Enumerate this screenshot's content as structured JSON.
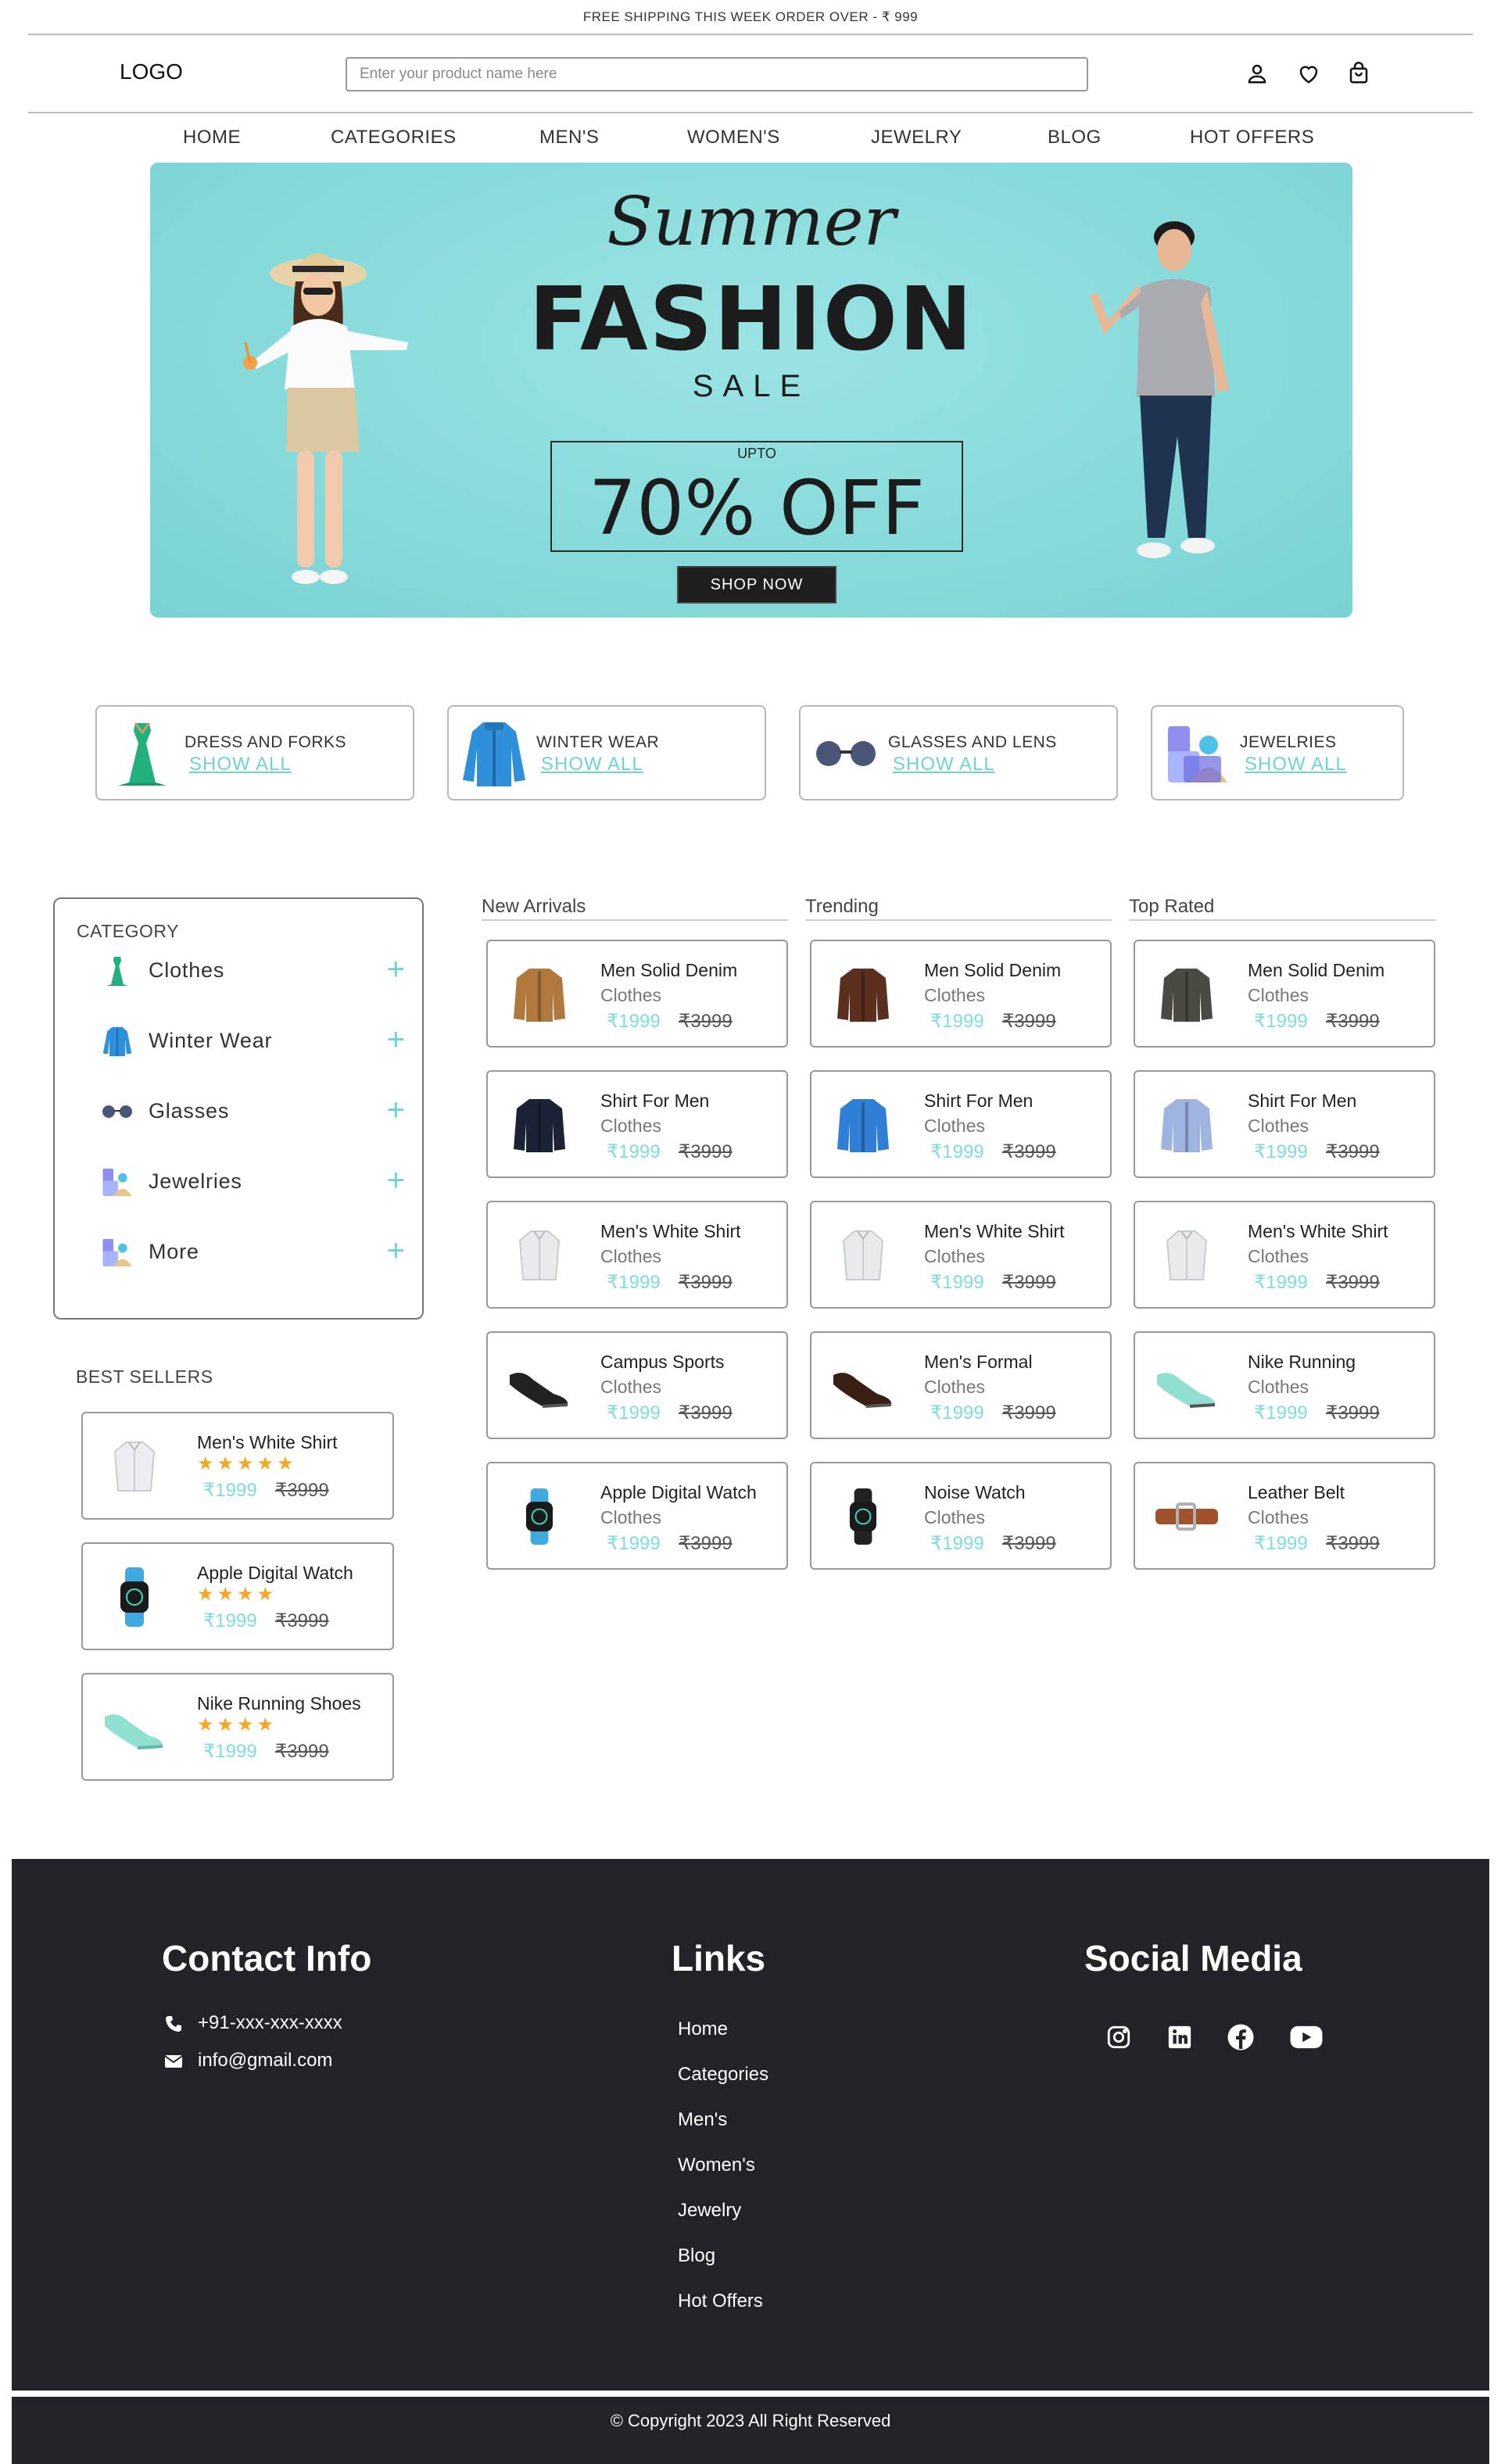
{
  "topbar": {
    "text": "FREE SHIPPING THIS WEEK ORDER OVER - ₹ 999"
  },
  "header": {
    "logo": "LOGO",
    "search_placeholder": "Enter your product name here",
    "icons": [
      "user-icon",
      "heart-icon",
      "shopping-bag-icon"
    ]
  },
  "nav": [
    "HOME",
    "CATEGORIES",
    "MEN'S",
    "WOMEN'S",
    "JEWELRY",
    "BLOG",
    "HOT OFFERS"
  ],
  "banner": {
    "script_title": "Summer",
    "title": "FASHION",
    "subtitle": "SALE",
    "upto": "UPTO",
    "offer": "70% OFF",
    "button": "SHOP NOW",
    "bg_color": "#86dada"
  },
  "categories": [
    {
      "title": "DRESS AND FORKS",
      "link": "SHOW ALL",
      "icon": "dress-icon"
    },
    {
      "title": "WINTER WEAR",
      "link": "SHOW ALL",
      "icon": "jacket-icon"
    },
    {
      "title": "GLASSES AND LENS",
      "link": "SHOW ALL",
      "icon": "glasses-icon"
    },
    {
      "title": "JEWELRIES",
      "link": "SHOW ALL",
      "icon": "jewelry-icon"
    }
  ],
  "sidebar": {
    "heading": "CATEGORY",
    "items": [
      {
        "label": "Clothes",
        "icon": "dress-icon"
      },
      {
        "label": "Winter Wear",
        "icon": "jacket-icon"
      },
      {
        "label": "Glasses",
        "icon": "glasses-icon"
      },
      {
        "label": "Jewelries",
        "icon": "jewelry-icon"
      },
      {
        "label": "More",
        "icon": "jewelry-icon"
      }
    ],
    "plus": "+"
  },
  "best_sellers": {
    "heading": "BEST SELLERS",
    "items": [
      {
        "name": "Men's White Shirt",
        "stars": "★★★★★",
        "rating": 5,
        "price": "₹1999",
        "old_price": "₹3999",
        "icon": "white-shirt-icon"
      },
      {
        "name": "Apple Digital Watch",
        "stars": "★★★★",
        "rating": 4,
        "price": "₹1999",
        "old_price": "₹3999",
        "icon": "watch-icon"
      },
      {
        "name": "Nike Running Shoes",
        "stars": "★★★★",
        "rating": 4,
        "price": "₹1999",
        "old_price": "₹3999",
        "icon": "shoe-icon"
      }
    ]
  },
  "columns": [
    {
      "heading": "New Arrivals",
      "items": [
        {
          "name": "Men Solid Denim",
          "category": "Clothes",
          "price": "₹1999",
          "old_price": "₹3999",
          "icon": "brown-jacket-icon",
          "color": "#b0783c"
        },
        {
          "name": "Shirt For Men",
          "category": "Clothes",
          "price": "₹1999",
          "old_price": "₹3999",
          "icon": "navy-jacket-icon",
          "color": "#1b2235"
        },
        {
          "name": "Men's White Shirt",
          "category": "Clothes",
          "price": "₹1999",
          "old_price": "₹3999",
          "icon": "white-shirt-icon",
          "color": "#e9eaec"
        },
        {
          "name": "Campus Sports",
          "category": "Clothes",
          "price": "₹1999",
          "old_price": "₹3999",
          "icon": "sports-shoe-icon",
          "color": "#222222"
        },
        {
          "name": "Apple Digital Watch",
          "category": "Clothes",
          "price": "₹1999",
          "old_price": "₹3999",
          "icon": "watch-icon",
          "color": "#3fa9e0"
        }
      ]
    },
    {
      "heading": "Trending",
      "items": [
        {
          "name": "Men Solid Denim",
          "category": "Clothes",
          "price": "₹1999",
          "old_price": "₹3999",
          "icon": "leather-jacket-icon",
          "color": "#5a2f20"
        },
        {
          "name": "Shirt For Men",
          "category": "Clothes",
          "price": "₹1999",
          "old_price": "₹3999",
          "icon": "hoodie-icon",
          "color": "#2f7fd6"
        },
        {
          "name": "Men's White Shirt",
          "category": "Clothes",
          "price": "₹1999",
          "old_price": "₹3999",
          "icon": "white-shirt-icon",
          "color": "#e9eaec"
        },
        {
          "name": "Men's Formal",
          "category": "Clothes",
          "price": "₹1999",
          "old_price": "₹3999",
          "icon": "formal-shoe-icon",
          "color": "#3a1f14"
        },
        {
          "name": "Noise Watch",
          "category": "Clothes",
          "price": "₹1999",
          "old_price": "₹3999",
          "icon": "watch-icon",
          "color": "#222222"
        }
      ]
    },
    {
      "heading": "Top Rated",
      "items": [
        {
          "name": "Men Solid Denim",
          "category": "Clothes",
          "price": "₹1999",
          "old_price": "₹3999",
          "icon": "olive-jacket-icon",
          "color": "#4a4a42"
        },
        {
          "name": "Shirt For Men",
          "category": "Clothes",
          "price": "₹1999",
          "old_price": "₹3999",
          "icon": "sweater-icon",
          "color": "#9fb4e0"
        },
        {
          "name": "Men's White Shirt",
          "category": "Clothes",
          "price": "₹1999",
          "old_price": "₹3999",
          "icon": "white-shirt-icon",
          "color": "#e9eaec"
        },
        {
          "name": "Nike Running",
          "category": "Clothes",
          "price": "₹1999",
          "old_price": "₹3999",
          "icon": "running-shoe-icon",
          "color": "#8fe0d0"
        },
        {
          "name": "Leather Belt",
          "category": "Clothes",
          "price": "₹1999",
          "old_price": "₹3999",
          "icon": "belt-icon",
          "color": "#a0522d"
        }
      ]
    }
  ],
  "footer": {
    "contact_heading": "Contact Info",
    "phone": "+91-xxx-xxx-xxxx",
    "email": "info@gmail.com",
    "links_heading": "Links",
    "links": [
      "Home",
      "Categories",
      "Men's",
      "Women's",
      "Jewelry",
      "Blog",
      "Hot Offers"
    ],
    "social_heading": "Social Media",
    "social_icons": [
      "instagram-icon",
      "linkedin-icon",
      "facebook-icon",
      "youtube-icon"
    ],
    "copyright": "© Copyright 2023 All Right Reserved",
    "bg_color": "#232228"
  },
  "accent_color": "#6fd3d3",
  "star_color": "#f5a623"
}
